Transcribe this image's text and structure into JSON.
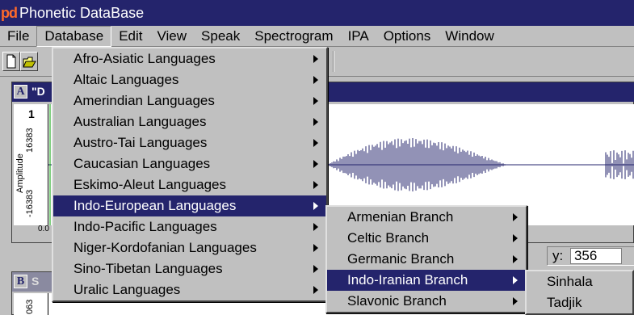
{
  "app": {
    "logo": "pd",
    "title": "Phonetic DataBase"
  },
  "menubar": [
    "File",
    "Database",
    "Edit",
    "View",
    "Speak",
    "Spectrogram",
    "IPA",
    "Options",
    "Window"
  ],
  "windowA": {
    "badge": "A",
    "title_fragment": "\"D",
    "channel": "1",
    "y_max": "16383",
    "y_label": "Amplitude",
    "y_min": "-16383",
    "x_tick": "0.0"
  },
  "status": {
    "y_label": "y:",
    "y_value": "356"
  },
  "windowB": {
    "badge": "B",
    "title_fragment": "S",
    "y_tick": "063"
  },
  "database_menu": [
    "Afro-Asiatic Languages",
    "Altaic Languages",
    "Amerindian Languages",
    "Australian Languages",
    "Austro-Tai Languages",
    "Caucasian Languages",
    "Eskimo-Aleut Languages",
    "Indo-European Languages",
    "Indo-Pacific Languages",
    "Niger-Kordofanian Languages",
    "Sino-Tibetan Languages",
    "Uralic Languages"
  ],
  "indo_european_menu": [
    "Armenian Branch",
    "Celtic Branch",
    "Germanic Branch",
    "Indo-Iranian Branch",
    "Slavonic Branch"
  ],
  "indo_iranian_menu": [
    "Sinhala",
    "Tadjik"
  ],
  "highlight_color": "#24246c"
}
